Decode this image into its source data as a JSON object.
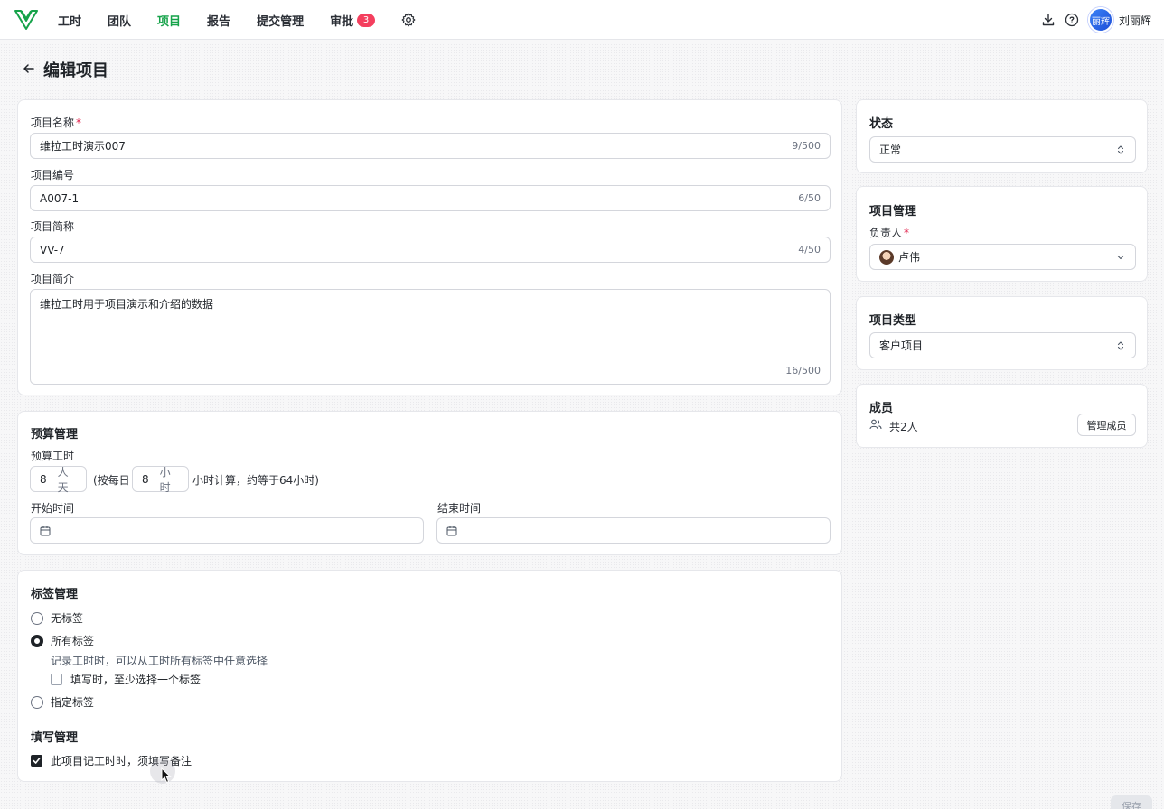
{
  "nav": {
    "items": [
      {
        "label": "工时",
        "active": false
      },
      {
        "label": "团队",
        "active": false
      },
      {
        "label": "项目",
        "active": true
      },
      {
        "label": "报告",
        "active": false
      },
      {
        "label": "提交管理",
        "active": false
      },
      {
        "label": "审批",
        "active": false,
        "badge": "3"
      }
    ],
    "user_name": "刘丽辉",
    "avatar_text": "丽辉",
    "accent_color": "#16a34a",
    "badge_color": "#f43f5e"
  },
  "page": {
    "title": "编辑项目",
    "save_label": "保存"
  },
  "basic": {
    "name": {
      "label": "项目名称",
      "required_mark": "*",
      "value": "维拉工时演示007",
      "count": "9/500"
    },
    "code": {
      "label": "项目编号",
      "value": "A007-1",
      "count": "6/50"
    },
    "short_name": {
      "label": "项目简称",
      "value": "VV-7",
      "count": "4/50"
    },
    "description": {
      "label": "项目简介",
      "value": "维拉工时用于项目演示和介绍的数据",
      "count": "16/500"
    }
  },
  "budget": {
    "title": "预算管理",
    "hours_label": "预算工时",
    "days_value": "8",
    "days_unit": "人天",
    "per_day_prefix": "(按每日",
    "hours_per_day_value": "8",
    "hours_unit": "小时",
    "suffix": "小时计算，约等于64小时)",
    "start_label": "开始时间",
    "end_label": "结束时间"
  },
  "tags": {
    "title": "标签管理",
    "options": [
      {
        "label": "无标签",
        "selected": false
      },
      {
        "label": "所有标签",
        "selected": true
      },
      {
        "label": "指定标签",
        "selected": false
      }
    ],
    "all_hint": "记录工时时，可以从工时所有标签中任意选择",
    "require_one_label": "填写时，至少选择一个标签",
    "require_one_checked": false
  },
  "fill": {
    "title": "填写管理",
    "require_note_label": "此项目记工时时，须填写备注",
    "require_note_checked": true
  },
  "status": {
    "title": "状态",
    "value": "正常"
  },
  "management": {
    "title": "项目管理",
    "owner_label": "负责人",
    "required_mark": "*",
    "owner_value": "卢伟"
  },
  "project_type": {
    "title": "项目类型",
    "value": "客户项目"
  },
  "members": {
    "title": "成员",
    "count_text": "共2人",
    "manage_label": "管理成员"
  }
}
